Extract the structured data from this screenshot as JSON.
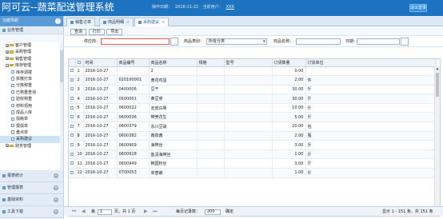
{
  "header": {
    "title": "阿可云--蔬菜配送管理系统",
    "date_label": "操作日期：",
    "date_value": "2016-11-22",
    "user_label": "当前用户：",
    "user_value": "XXX",
    "logout_label": "退出登录"
  },
  "sidebar": {
    "title": "功能导航",
    "collapse_icon": "«",
    "groups_top": {
      "label": "业务管理"
    },
    "tree": [
      {
        "label": "客户管理",
        "level": 1,
        "type": "folder"
      },
      {
        "label": "采购管理",
        "level": 1,
        "type": "folder"
      },
      {
        "label": "销售管理",
        "level": 1,
        "type": "folder"
      },
      {
        "label": "库存管理",
        "level": 1,
        "type": "folder-open"
      },
      {
        "label": "库存调拨",
        "level": 2,
        "type": "page"
      },
      {
        "label": "拆散打单",
        "level": 2,
        "type": "page"
      },
      {
        "label": "分拣称重",
        "level": 2,
        "type": "page"
      },
      {
        "label": "已称重查询",
        "level": 2,
        "type": "page"
      },
      {
        "label": "验收称重",
        "level": 2,
        "type": "page"
      },
      {
        "label": "材料领用",
        "level": 2,
        "type": "page"
      },
      {
        "label": "成品入库",
        "level": 2,
        "type": "page"
      },
      {
        "label": "损耗单",
        "level": 2,
        "type": "page"
      },
      {
        "label": "报损单",
        "level": 2,
        "type": "page"
      },
      {
        "label": "盘点单",
        "level": 2,
        "type": "page"
      },
      {
        "label": "采购建议",
        "level": 2,
        "type": "page",
        "selected": true
      },
      {
        "label": "财务管理",
        "level": 1,
        "type": "folder"
      }
    ],
    "groups_bottom": [
      {
        "label": "报表统计"
      },
      {
        "label": "管理报表"
      },
      {
        "label": "基础资料"
      },
      {
        "label": "工具下载"
      }
    ]
  },
  "tabs": [
    {
      "label": "销售订单",
      "active": false,
      "closable": false
    },
    {
      "label": "商品明细",
      "active": false,
      "closable": true
    },
    {
      "label": "采购建议",
      "active": true,
      "closable": true
    }
  ],
  "toolbar": {
    "query": "查询",
    "print": "打印",
    "export": "导出"
  },
  "filters": {
    "supplier_label": "供应商：",
    "supplier_value": "",
    "category_label": "商品类别：",
    "category_value": "所有分类",
    "name_label": "商品名称：",
    "name_value": "",
    "date_label": "日期：",
    "date_value": ""
  },
  "grid": {
    "columns": [
      "",
      "时间",
      "商品编号",
      "商品名称",
      "规格",
      "型号",
      "订货数量",
      "订货单位"
    ],
    "rows": [
      {
        "n": "1",
        "date": "2016-10-27",
        "code": "",
        "name": "2",
        "spec": "",
        "model": "",
        "qty": "0.00",
        "unit": ""
      },
      {
        "n": "2",
        "date": "2016-10-27",
        "code": "020100001",
        "name": "黄花鸡蛋",
        "spec": "",
        "model": "",
        "qty": "2.00",
        "unit": "件"
      },
      {
        "n": "3",
        "date": "2016-10-27",
        "code": "0400006",
        "name": "豆干",
        "spec": "",
        "model": "",
        "qty": "30.00",
        "unit": "斤"
      },
      {
        "n": "4",
        "date": "2016-10-27",
        "code": "0500001",
        "name": "黄豆芽",
        "spec": "",
        "model": "",
        "qty": "30.00",
        "unit": "斤"
      },
      {
        "n": "5",
        "date": "2016-10-27",
        "code": "0600022",
        "name": "去皮白果",
        "spec": "",
        "model": "",
        "qty": "10.00",
        "unit": "斤"
      },
      {
        "n": "6",
        "date": "2016-10-27",
        "code": "0600036",
        "name": "带壳花生",
        "spec": "",
        "model": "",
        "qty": "5.00",
        "unit": "斤"
      },
      {
        "n": "7",
        "date": "2016-10-27",
        "code": "0600379",
        "name": "永川豆豉",
        "spec": "",
        "model": "",
        "qty": "20.00",
        "unit": "包"
      },
      {
        "n": "8",
        "date": "2016-10-27",
        "code": "0600382",
        "name": "番茄酱",
        "spec": "",
        "model": "",
        "qty": "2.00",
        "unit": "瓶"
      },
      {
        "n": "9",
        "date": "2016-10-27",
        "code": "0600909",
        "name": "海带丝",
        "spec": "",
        "model": "",
        "qty": "3.00",
        "unit": "斤"
      },
      {
        "n": "10",
        "date": "2016-10-27",
        "code": "0600918",
        "name": "盐渍海带丝",
        "spec": "",
        "model": "",
        "qty": "1.00",
        "unit": "斤"
      },
      {
        "n": "11",
        "date": "2016-10-27",
        "code": "0600949",
        "name": "韩国粉丝",
        "spec": "",
        "model": "",
        "qty": "3.00",
        "unit": "斤"
      },
      {
        "n": "12",
        "date": "2016-10-27",
        "code": "0700053",
        "name": "单葱嫩",
        "spec": "",
        "model": "",
        "qty": "1.00",
        "unit": "斤"
      }
    ]
  },
  "pager": {
    "first": "⏮",
    "prev": "◀",
    "page_label": "第",
    "page_value": "1",
    "of": "页，共 1 页",
    "next": "▶",
    "last": "⏭",
    "per_page_label": "每页记录数：",
    "per_page_value": "200",
    "confirm": "确定",
    "summary": "显示 1 - 151 条，共 151 条"
  }
}
